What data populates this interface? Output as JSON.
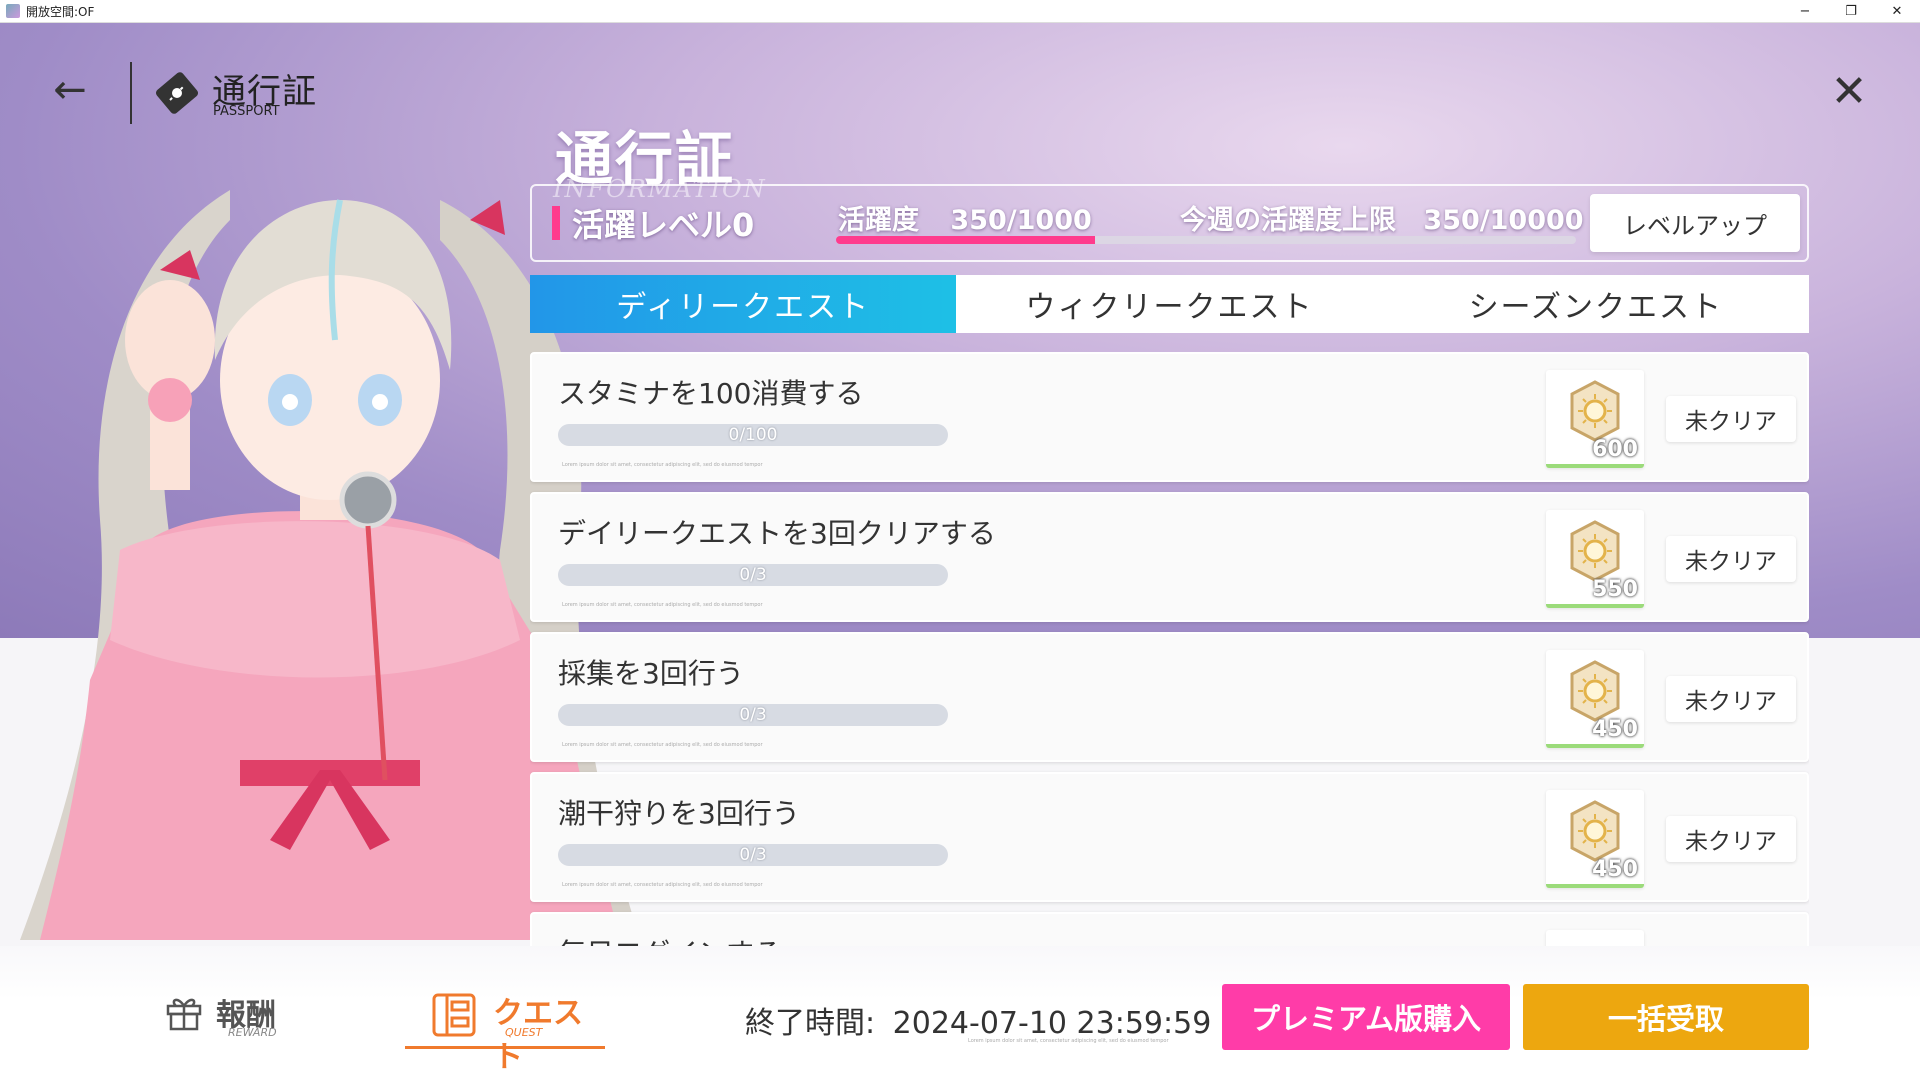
{
  "window": {
    "title": "開放空間:OF",
    "minimize": "−",
    "maximize": "❐",
    "close": "✕"
  },
  "header": {
    "back_glyph": "←",
    "title": "通行証",
    "subtitle": "PASSPORT",
    "close_glyph": "✕"
  },
  "info": {
    "big_title": "通行証",
    "watermark": "INFORMATION",
    "level_label": "活躍レベル0",
    "activity_label": "活躍度",
    "activity_value": "350/1000",
    "activity_progress": 0.35,
    "weekly_label": "今週の活躍度上限",
    "weekly_value": "350/10000",
    "levelup_button": "レベルアップ"
  },
  "tabs": [
    {
      "label": "ディリークエスト",
      "active": true
    },
    {
      "label": "ウィクリークエスト",
      "active": false
    },
    {
      "label": "シーズンクエスト",
      "active": false
    }
  ],
  "quests": [
    {
      "name": "スタミナを100消費する",
      "progress_text": "0/100",
      "progress": 0,
      "reward": "600",
      "status": "未クリア"
    },
    {
      "name": "デイリークエストを3回クリアする",
      "progress_text": "0/3",
      "progress": 0,
      "reward": "550",
      "status": "未クリア"
    },
    {
      "name": "採集を3回行う",
      "progress_text": "0/3",
      "progress": 0,
      "reward": "450",
      "status": "未クリア"
    },
    {
      "name": "潮干狩りを3回行う",
      "progress_text": "0/3",
      "progress": 0,
      "reward": "450",
      "status": "未クリア"
    },
    {
      "name": "毎日ログインする",
      "progress_text": "",
      "progress": 0,
      "reward": "",
      "status": ""
    }
  ],
  "quest_tiny_text": "Lorem ipsum dolor sit amet, consectetur adipiscing elit, sed do eiusmod tempor",
  "bottom": {
    "nav_reward_label": "報酬",
    "nav_reward_sub": "REWARD",
    "nav_quest_label": "クエスト",
    "nav_quest_sub": "QUEST",
    "end_time_label": "終了時間:",
    "end_time_value": "2024-07-10 23:59:59",
    "premium_button": "プレミアム版購入",
    "collect_button": "一括受取"
  },
  "colors": {
    "accent_pink": "#ff3ca8",
    "tab_blue": "#2296e8",
    "collect_orange": "#eda70f",
    "quest_orange": "#f07a2d"
  },
  "icons": {
    "reward": "gift-icon",
    "quest": "quest-list-icon",
    "passport": "ticket-icon",
    "currency": "sun-crystal-icon"
  }
}
